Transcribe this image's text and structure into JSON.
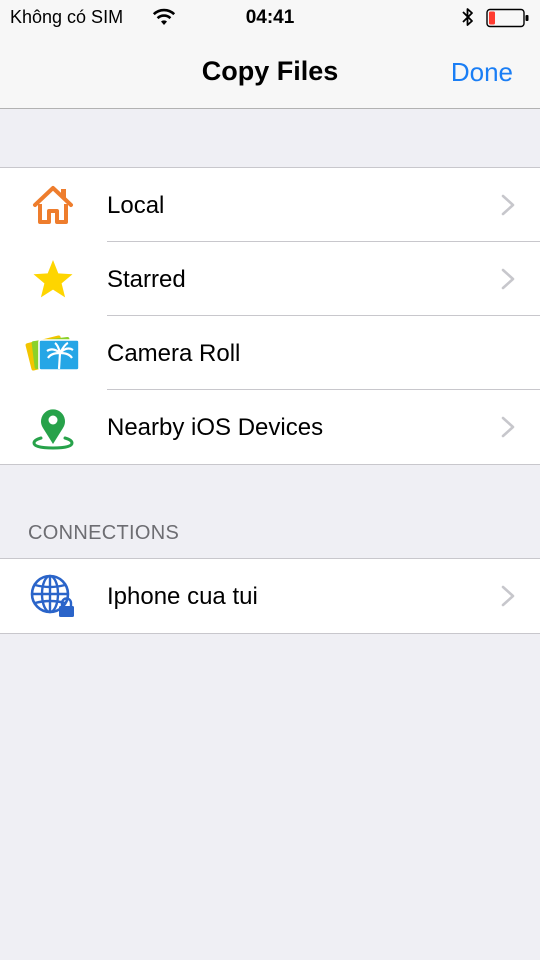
{
  "status_bar": {
    "carrier": "Không có SIM",
    "time": "04:41",
    "battery_color": "#ff3b30"
  },
  "nav": {
    "title": "Copy Files",
    "done_label": "Done",
    "accent_color": "#1a7ef5"
  },
  "locations": [
    {
      "label": "Local",
      "icon": "house-icon",
      "chevron": true
    },
    {
      "label": "Starred",
      "icon": "star-icon",
      "chevron": true
    },
    {
      "label": "Camera Roll",
      "icon": "camera-roll-icon",
      "chevron": false
    },
    {
      "label": "Nearby iOS Devices",
      "icon": "location-pin-icon",
      "chevron": true
    }
  ],
  "connections": {
    "header": "CONNECTIONS",
    "items": [
      {
        "label": "Iphone cua tui",
        "icon": "globe-lock-icon",
        "chevron": true
      }
    ]
  }
}
